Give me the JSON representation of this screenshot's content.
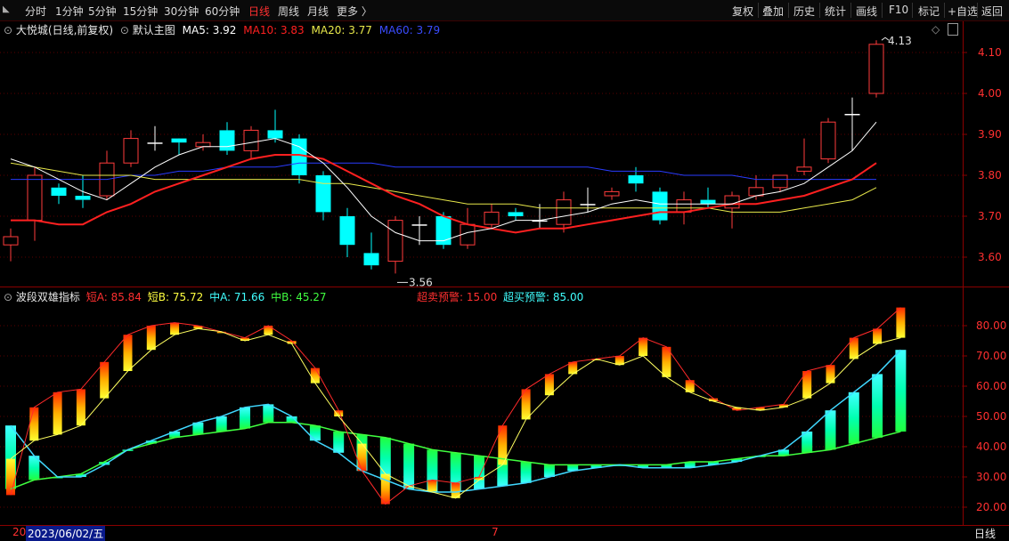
{
  "toolbar": {
    "periods": [
      "分时",
      "1分钟",
      "5分钟",
      "15分钟",
      "30分钟",
      "60分钟",
      "日线",
      "周线",
      "月线",
      "更多 〉"
    ],
    "active_period": "日线",
    "tools": [
      "复权",
      "叠加",
      "历史",
      "统计",
      "画线",
      "F10",
      "标记",
      "+自选",
      "返回"
    ]
  },
  "main_legend": {
    "title": "大悦城(日线,前复权)",
    "template": "默认主图",
    "ma5": "MA5: 3.92",
    "ma10": "MA10: 3.83",
    "ma20": "MA20: 3.77",
    "ma60": "MA60: 3.79"
  },
  "sub_legend": {
    "name": "波段双雄指标",
    "short_a": "短A: 85.84",
    "short_b": "短B: 75.72",
    "mid_a": "中A: 71.66",
    "mid_b": "中B: 45.27",
    "oversell": "超卖预警: 15.00",
    "overbuy": "超买预警: 85.00"
  },
  "annotations": {
    "high": "4.13",
    "low": "3.56"
  },
  "bottom": {
    "left_stub": "20",
    "date": "2023/06/02/五",
    "month": "7",
    "period_label": "日线"
  },
  "colors": {
    "up": "#ff3b3b",
    "down": "#00ffff",
    "ma5": "#ffffff",
    "ma10": "#ff2020",
    "ma20": "#e8e84a",
    "ma60": "#2a3cff"
  },
  "chart_data": [
    {
      "type": "candlestick",
      "y_ticks": [
        "4.10",
        "4.00",
        "3.90",
        "3.80",
        "3.70",
        "3.60"
      ],
      "ylim": [
        3.53,
        4.18
      ],
      "candles": [
        {
          "o": 3.63,
          "h": 3.67,
          "l": 3.59,
          "c": 3.65
        },
        {
          "o": 3.69,
          "h": 3.82,
          "l": 3.64,
          "c": 3.8
        },
        {
          "o": 3.77,
          "h": 3.78,
          "l": 3.73,
          "c": 3.75
        },
        {
          "o": 3.75,
          "h": 3.8,
          "l": 3.72,
          "c": 3.74
        },
        {
          "o": 3.75,
          "h": 3.86,
          "l": 3.74,
          "c": 3.83
        },
        {
          "o": 3.83,
          "h": 3.91,
          "l": 3.82,
          "c": 3.89
        },
        {
          "o": 3.88,
          "h": 3.92,
          "l": 3.86,
          "c": 3.88
        },
        {
          "o": 3.89,
          "h": 3.88,
          "l": 3.85,
          "c": 3.88
        },
        {
          "o": 3.87,
          "h": 3.9,
          "l": 3.86,
          "c": 3.88
        },
        {
          "o": 3.91,
          "h": 3.93,
          "l": 3.85,
          "c": 3.86
        },
        {
          "o": 3.86,
          "h": 3.92,
          "l": 3.84,
          "c": 3.91
        },
        {
          "o": 3.91,
          "h": 3.96,
          "l": 3.88,
          "c": 3.89
        },
        {
          "o": 3.89,
          "h": 3.9,
          "l": 3.78,
          "c": 3.8
        },
        {
          "o": 3.8,
          "h": 3.81,
          "l": 3.69,
          "c": 3.71
        },
        {
          "o": 3.7,
          "h": 3.72,
          "l": 3.6,
          "c": 3.63
        },
        {
          "o": 3.61,
          "h": 3.66,
          "l": 3.57,
          "c": 3.58
        },
        {
          "o": 3.59,
          "h": 3.7,
          "l": 3.56,
          "c": 3.69
        },
        {
          "o": 3.68,
          "h": 3.7,
          "l": 3.63,
          "c": 3.68
        },
        {
          "o": 3.7,
          "h": 3.71,
          "l": 3.62,
          "c": 3.63
        },
        {
          "o": 3.63,
          "h": 3.72,
          "l": 3.62,
          "c": 3.68
        },
        {
          "o": 3.68,
          "h": 3.73,
          "l": 3.67,
          "c": 3.71
        },
        {
          "o": 3.71,
          "h": 3.72,
          "l": 3.69,
          "c": 3.7
        },
        {
          "o": 3.69,
          "h": 3.73,
          "l": 3.67,
          "c": 3.69
        },
        {
          "o": 3.68,
          "h": 3.76,
          "l": 3.66,
          "c": 3.74
        },
        {
          "o": 3.73,
          "h": 3.77,
          "l": 3.71,
          "c": 3.73
        },
        {
          "o": 3.75,
          "h": 3.77,
          "l": 3.74,
          "c": 3.76
        },
        {
          "o": 3.8,
          "h": 3.82,
          "l": 3.76,
          "c": 3.78
        },
        {
          "o": 3.76,
          "h": 3.77,
          "l": 3.68,
          "c": 3.69
        },
        {
          "o": 3.71,
          "h": 3.76,
          "l": 3.68,
          "c": 3.74
        },
        {
          "o": 3.74,
          "h": 3.77,
          "l": 3.72,
          "c": 3.73
        },
        {
          "o": 3.72,
          "h": 3.76,
          "l": 3.67,
          "c": 3.75
        },
        {
          "o": 3.75,
          "h": 3.8,
          "l": 3.74,
          "c": 3.77
        },
        {
          "o": 3.77,
          "h": 3.8,
          "l": 3.76,
          "c": 3.8
        },
        {
          "o": 3.81,
          "h": 3.89,
          "l": 3.8,
          "c": 3.82
        },
        {
          "o": 3.84,
          "h": 3.94,
          "l": 3.83,
          "c": 3.93
        },
        {
          "o": 3.95,
          "h": 3.99,
          "l": 3.86,
          "c": 3.95
        },
        {
          "o": 4.0,
          "h": 4.13,
          "l": 3.99,
          "c": 4.12
        }
      ],
      "ma5": [
        3.84,
        3.82,
        3.79,
        3.76,
        3.74,
        3.78,
        3.82,
        3.85,
        3.87,
        3.87,
        3.88,
        3.89,
        3.87,
        3.83,
        3.77,
        3.7,
        3.66,
        3.64,
        3.64,
        3.66,
        3.67,
        3.69,
        3.69,
        3.7,
        3.71,
        3.73,
        3.74,
        3.73,
        3.73,
        3.73,
        3.73,
        3.75,
        3.76,
        3.78,
        3.82,
        3.86,
        3.93
      ],
      "ma10": [
        3.69,
        3.69,
        3.68,
        3.68,
        3.71,
        3.73,
        3.76,
        3.78,
        3.8,
        3.82,
        3.84,
        3.85,
        3.85,
        3.84,
        3.81,
        3.78,
        3.75,
        3.73,
        3.7,
        3.68,
        3.67,
        3.66,
        3.67,
        3.67,
        3.68,
        3.69,
        3.7,
        3.71,
        3.71,
        3.72,
        3.73,
        3.73,
        3.74,
        3.75,
        3.77,
        3.79,
        3.83
      ],
      "ma20": [
        3.83,
        3.82,
        3.81,
        3.8,
        3.8,
        3.8,
        3.79,
        3.79,
        3.79,
        3.79,
        3.79,
        3.79,
        3.79,
        3.78,
        3.78,
        3.77,
        3.76,
        3.75,
        3.74,
        3.73,
        3.73,
        3.73,
        3.72,
        3.72,
        3.72,
        3.72,
        3.72,
        3.72,
        3.72,
        3.72,
        3.71,
        3.71,
        3.71,
        3.72,
        3.73,
        3.74,
        3.77
      ],
      "ma60": [
        3.79,
        3.79,
        3.79,
        3.79,
        3.79,
        3.8,
        3.8,
        3.81,
        3.81,
        3.82,
        3.82,
        3.82,
        3.83,
        3.83,
        3.83,
        3.83,
        3.82,
        3.82,
        3.82,
        3.82,
        3.82,
        3.82,
        3.82,
        3.82,
        3.82,
        3.81,
        3.81,
        3.81,
        3.8,
        3.8,
        3.8,
        3.79,
        3.79,
        3.79,
        3.79,
        3.79,
        3.79
      ]
    },
    {
      "type": "indicator",
      "y_ticks": [
        "80.00",
        "70.00",
        "60.00",
        "50.00",
        "40.00",
        "30.00",
        "20.00"
      ],
      "ylim": [
        15,
        88
      ],
      "short_a": [
        24,
        53,
        58,
        59,
        68,
        77,
        80,
        81,
        80,
        78,
        76,
        80,
        75,
        66,
        52,
        32,
        21,
        27,
        29,
        28,
        30,
        47,
        59,
        64,
        68,
        69,
        70,
        76,
        73,
        62,
        56,
        52,
        53,
        54,
        65,
        67,
        76,
        79,
        86
      ],
      "short_b": [
        36,
        42,
        44,
        47,
        56,
        65,
        72,
        77,
        79,
        78,
        75,
        77,
        74,
        61,
        50,
        41,
        31,
        27,
        25,
        23,
        29,
        34,
        49,
        57,
        64,
        69,
        67,
        70,
        63,
        58,
        55,
        53,
        52,
        53,
        56,
        61,
        69,
        74,
        76
      ],
      "mid_a": [
        47,
        37,
        30,
        30,
        34,
        39,
        42,
        45,
        48,
        50,
        53,
        54,
        50,
        42,
        38,
        32,
        29,
        26,
        25,
        25,
        26,
        27,
        28,
        30,
        32,
        33,
        34,
        33,
        33,
        33,
        34,
        35,
        37,
        39,
        45,
        52,
        58,
        64,
        72
      ],
      "mid_b": [
        26,
        29,
        30,
        31,
        35,
        39,
        41,
        43,
        44,
        45,
        46,
        48,
        48,
        47,
        45,
        44,
        43,
        41,
        39,
        38,
        37,
        36,
        35,
        34,
        34,
        34,
        34,
        34,
        34,
        35,
        35,
        36,
        37,
        37,
        38,
        39,
        41,
        43,
        45
      ],
      "oversell": 15.0,
      "overbuy": 85.0
    }
  ]
}
